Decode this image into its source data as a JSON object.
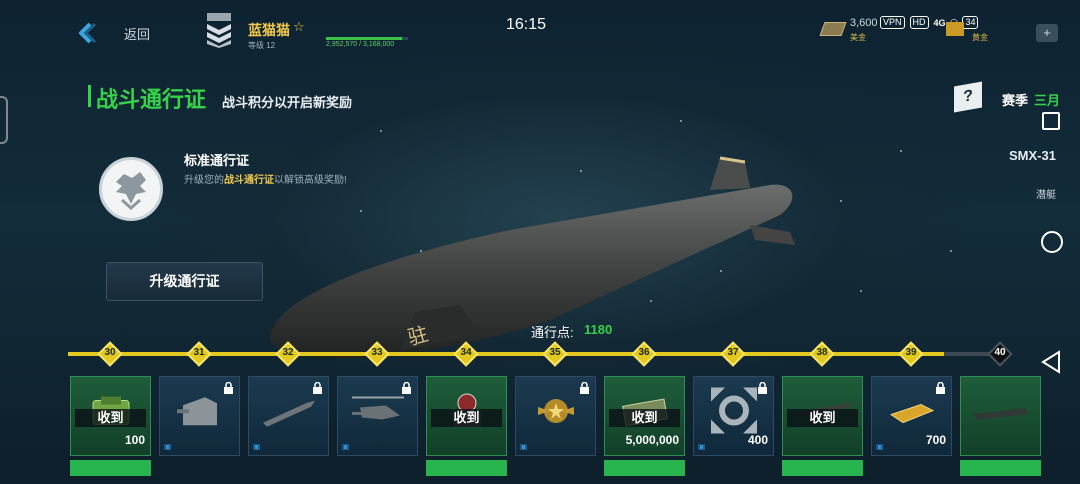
{
  "topbar": {
    "back_label": "返回",
    "player_name": "蓝猫猫",
    "player_star": "☆",
    "level_text": "等级 12",
    "xp_text": "2,952,570 / 3,168,000",
    "xp_progress": 0.93,
    "clock": "16:15",
    "currency1_value": "3,600",
    "currency1_label": "美金",
    "currency2_label": "黄金",
    "status_icons": [
      "VPN",
      "HD",
      "4G",
      "34"
    ],
    "plus": "+"
  },
  "header": {
    "title": "战斗通行证",
    "subtitle": "战斗积分以开启新奖励",
    "help": "?",
    "season_label": "赛季",
    "season_value": "三月"
  },
  "model": {
    "name": "SMX-31",
    "type": "潜艇"
  },
  "pass": {
    "title": "标准通行证",
    "desc_prefix": "升级您的",
    "desc_highlight": "战斗通行证",
    "desc_suffix": "以解锁高级奖励!",
    "upgrade_button": "升级通行证"
  },
  "progress": {
    "points_label": "通行点:",
    "points_value": "1180",
    "levels": [
      "30",
      "31",
      "32",
      "33",
      "34",
      "35",
      "36",
      "37",
      "38",
      "39",
      "40"
    ],
    "filled_fraction": 0.94
  },
  "rewards": [
    {
      "status": "收到",
      "amount": "100",
      "type": "green",
      "icon": "crate-icon",
      "locked": false
    },
    {
      "status": "",
      "amount": "",
      "type": "blue",
      "icon": "turret-icon",
      "locked": true
    },
    {
      "status": "",
      "amount": "",
      "type": "blue",
      "icon": "missile-icon",
      "locked": true
    },
    {
      "status": "",
      "amount": "",
      "type": "blue",
      "icon": "helicopter-icon",
      "locked": true
    },
    {
      "status": "收到",
      "amount": "",
      "type": "green",
      "icon": "gear-crate-icon",
      "locked": false
    },
    {
      "status": "",
      "amount": "",
      "type": "blue",
      "icon": "insignia-icon",
      "locked": true
    },
    {
      "status": "收到",
      "amount": "5,000,000",
      "type": "green",
      "icon": "cash-icon",
      "locked": false
    },
    {
      "status": "",
      "amount": "400",
      "type": "blue",
      "icon": "expand-icon",
      "locked": true
    },
    {
      "status": "收到",
      "amount": "",
      "type": "green",
      "icon": "rifle-icon",
      "locked": false
    },
    {
      "status": "",
      "amount": "700",
      "type": "blue",
      "icon": "gold-icon",
      "locked": true
    },
    {
      "status": "",
      "amount": "",
      "type": "green",
      "icon": "vessel-icon",
      "locked": false
    }
  ],
  "colors": {
    "accent": "#35d24a",
    "track": "#e2c81f",
    "gold": "#f1c84b"
  }
}
